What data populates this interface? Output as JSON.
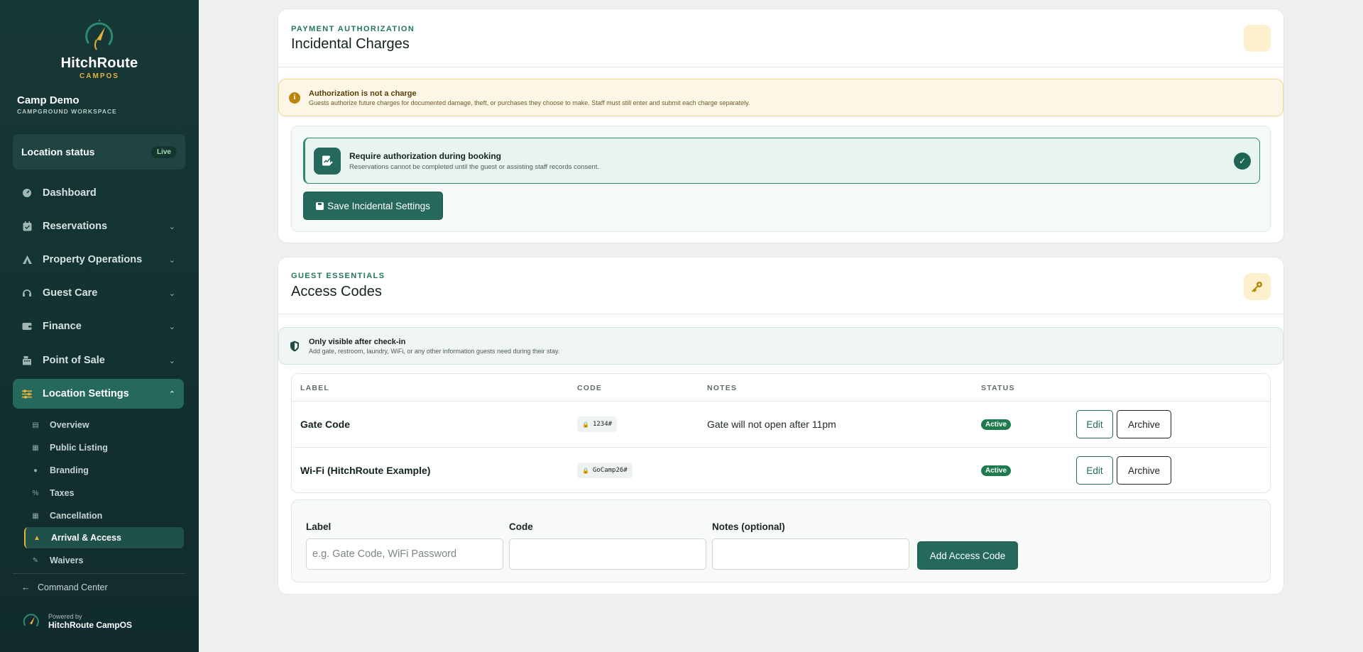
{
  "sidebar": {
    "brand_name": "HitchRoute",
    "brand_sub": "CAMPOS",
    "camp_name": "Camp Demo",
    "camp_sub": "CAMPGROUND WORKSPACE",
    "location_status_label": "Location status",
    "location_status_badge": "Live",
    "nav": [
      {
        "label": "Dashboard",
        "icon": "gauge-icon"
      },
      {
        "label": "Reservations",
        "icon": "calendar-icon"
      },
      {
        "label": "Property Operations",
        "icon": "tent-icon"
      },
      {
        "label": "Guest Care",
        "icon": "headset-icon"
      },
      {
        "label": "Finance",
        "icon": "wallet-icon"
      },
      {
        "label": "Point of Sale",
        "icon": "register-icon"
      },
      {
        "label": "Location Settings",
        "icon": "sliders-icon"
      }
    ],
    "sub_nav": [
      {
        "label": "Overview"
      },
      {
        "label": "Public Listing"
      },
      {
        "label": "Branding"
      },
      {
        "label": "Taxes"
      },
      {
        "label": "Cancellation"
      },
      {
        "label": "Arrival & Access"
      },
      {
        "label": "Waivers"
      }
    ],
    "command_center": "Command Center",
    "powered_by": "Powered by",
    "powered_brand": "HitchRoute CampOS"
  },
  "incidental": {
    "eyebrow": "PAYMENT AUTHORIZATION",
    "title": "Incidental Charges",
    "callout_title": "Authorization is not a charge",
    "callout_body": "Guests authorize future charges for documented damage, theft, or purchases they choose to make. Staff must still enter and submit each charge separately.",
    "require_title": "Require authorization during booking",
    "require_sub": "Reservations cannot be completed until the guest or assisting staff records consent.",
    "require_checked": true,
    "save_label": "Save Incidental Settings"
  },
  "access": {
    "eyebrow": "GUEST ESSENTIALS",
    "title": "Access Codes",
    "callout_title": "Only visible after check-in",
    "callout_body": "Add gate, restroom, laundry, WiFi, or any other information guests need during their stay.",
    "columns": {
      "label": "LABEL",
      "code": "CODE",
      "notes": "NOTES",
      "status": "STATUS"
    },
    "rows": [
      {
        "label": "Gate Code",
        "code": "1234#",
        "notes": "Gate will not open after 11pm",
        "status": "Active"
      },
      {
        "label": "Wi-Fi (HitchRoute Example)",
        "code": "GoCamp26#",
        "notes": "",
        "status": "Active"
      }
    ],
    "edit_label": "Edit",
    "archive_label": "Archive",
    "form": {
      "label_title": "Label",
      "label_placeholder": "e.g. Gate Code, WiFi Password",
      "code_title": "Code",
      "notes_title": "Notes (optional)",
      "add_label": "Add Access Code"
    }
  },
  "colors": {
    "sidebar_bg": "#163836",
    "accent": "#24695b",
    "gold": "#e6b23a",
    "status_active": "#1f7a4d"
  }
}
